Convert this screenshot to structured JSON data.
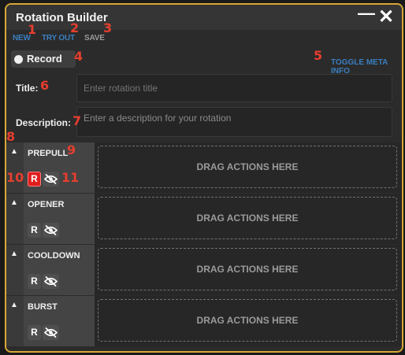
{
  "window": {
    "title": "Rotation Builder",
    "minimize_glyph": "—",
    "close_glyph": "✕",
    "border_color": "#d9a637"
  },
  "menu": {
    "new": "NEW",
    "try_out": "TRY OUT",
    "save": "SAVE",
    "active_color": "#3a7ebf",
    "inactive_color": "#9a9a9a"
  },
  "record": {
    "label": "Record",
    "icon": "record-dot-icon"
  },
  "toggle_meta": "TOGGLE META INFO",
  "form": {
    "title_label": "Title:",
    "title_placeholder": "Enter rotation title",
    "description_label": "Description:",
    "description_placeholder": "Enter a description for your rotation"
  },
  "sections": [
    {
      "name": "PREPULL",
      "r_label": "R",
      "r_active": true,
      "drop_text": "DRAG ACTIONS HERE"
    },
    {
      "name": "OPENER",
      "r_label": "R",
      "r_active": false,
      "drop_text": "DRAG ACTIONS HERE"
    },
    {
      "name": "COOLDOWN",
      "r_label": "R",
      "r_active": false,
      "drop_text": "DRAG ACTIONS HERE"
    },
    {
      "name": "BURST",
      "r_label": "R",
      "r_active": false,
      "drop_text": "DRAG ACTIONS HERE"
    }
  ],
  "annotations": [
    "1",
    "2",
    "3",
    "4",
    "5",
    "6",
    "7",
    "8",
    "9",
    "10",
    "11"
  ],
  "colors": {
    "annotation": "#e53e2f",
    "r_active": "#e11e1e"
  }
}
